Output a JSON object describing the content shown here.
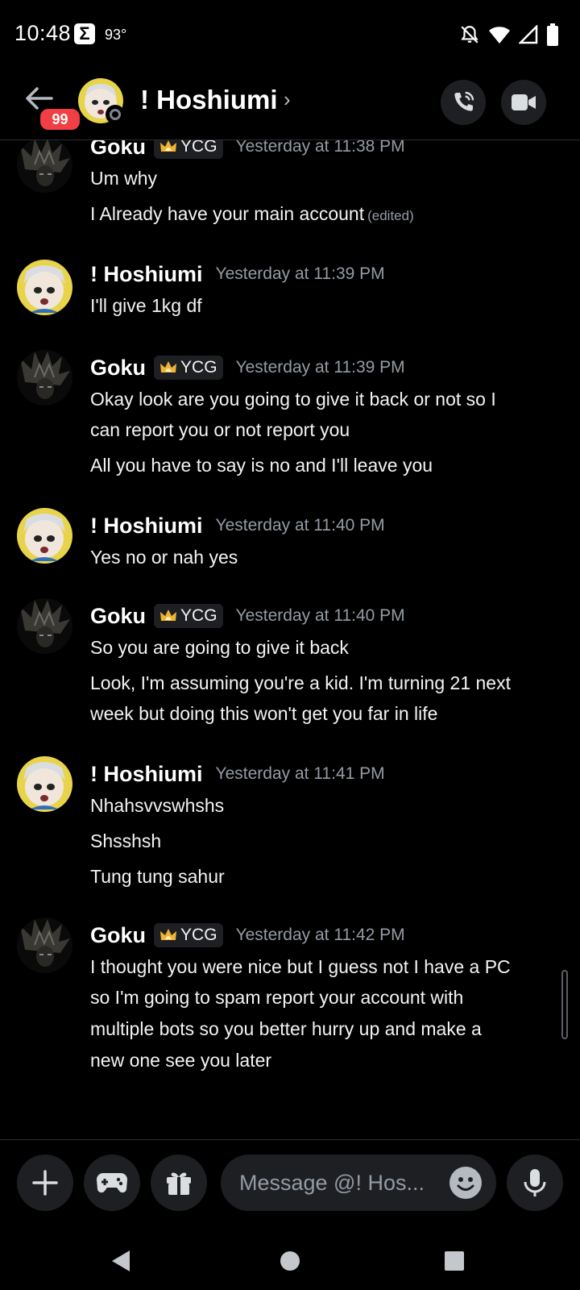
{
  "status_bar": {
    "time": "10:48",
    "temperature": "93°",
    "notif_icon": "sigma-icon",
    "icons": [
      "bell-off-icon",
      "wifi-icon",
      "signal-icon",
      "battery-icon"
    ]
  },
  "header": {
    "unread_badge": "99",
    "title": "! Hoshiumi",
    "chevron": "›"
  },
  "composer": {
    "placeholder": "Message @! Hos..."
  },
  "messages": [
    {
      "author": "Goku",
      "tag": "YCG",
      "timestamp": "Yesterday at 11:38 PM",
      "lines": [
        "Um why",
        "I Already have your main account"
      ],
      "edited_label": "(edited)"
    },
    {
      "author": "! Hoshiumi",
      "timestamp": "Yesterday at 11:39 PM",
      "lines": [
        "I'll give 1kg df"
      ]
    },
    {
      "author": "Goku",
      "tag": "YCG",
      "timestamp": "Yesterday at 11:39 PM",
      "lines": [
        "Okay look are you going to give it back or not so I",
        "can report you or not report you",
        "All you have to say is no and I'll leave you"
      ]
    },
    {
      "author": "! Hoshiumi",
      "timestamp": "Yesterday at 11:40 PM",
      "lines": [
        "Yes no or nah yes"
      ]
    },
    {
      "author": "Goku",
      "tag": "YCG",
      "timestamp": "Yesterday at 11:40 PM",
      "lines": [
        "So you are going to give it back",
        "Look, I'm assuming you're a kid. I'm  turning 21 next",
        "week  but doing this won't get you far in life"
      ]
    },
    {
      "author": "! Hoshiumi",
      "timestamp": "Yesterday at 11:41 PM",
      "lines": [
        "Nhahsvvswhshs",
        "Shsshsh",
        "Tung tung sahur"
      ]
    },
    {
      "author": "Goku",
      "tag": "YCG",
      "timestamp": "Yesterday at 11:42 PM",
      "lines": [
        "I thought you were nice but I guess not I have a PC",
        "so I'm going to spam report your account with",
        "multiple bots so you better hurry up and make a",
        "new one  see you later"
      ]
    }
  ]
}
